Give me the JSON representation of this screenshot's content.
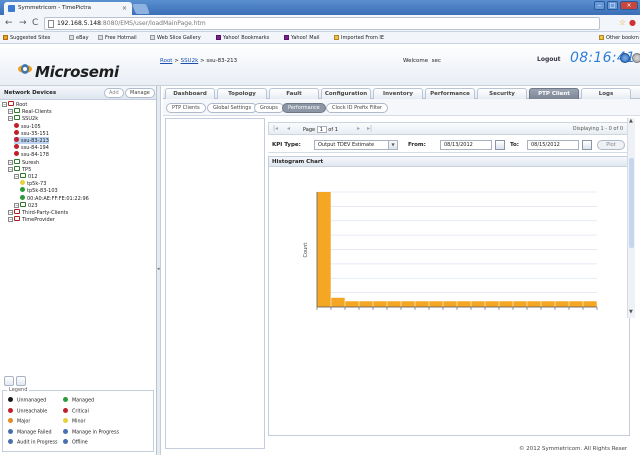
{
  "browser": {
    "tab_title": "Symmetricom - TimePictra",
    "url_host": "192.168.5.148",
    "url_path": ":8080/EMS/user/loadMainPage.htm",
    "bookmarks": [
      "Suggested Sites",
      "eBay",
      "Free Hotmail",
      "Web Slice Gallery",
      "Yahoo! Bookmarks",
      "Yahoo! Mail",
      "Imported From IE",
      "Other bookm"
    ]
  },
  "header": {
    "logo_text": "Microsemi",
    "breadcrumb_root": "Root",
    "breadcrumb_mid": "SSU2k",
    "breadcrumb_sep": " > ",
    "breadcrumb_current": "ssu-83-213",
    "welcome_label": "Welcome",
    "welcome_user": "sec",
    "logout": "Logout",
    "clock": "08:16:41"
  },
  "left_panel": {
    "title": "Network Devices",
    "add_label": "Add",
    "manage_label": "Manage",
    "tree": [
      {
        "label": "Root",
        "depth": 0,
        "icon": "folder",
        "color": "#b02020"
      },
      {
        "label": "Real-Clients",
        "depth": 1,
        "icon": "folder",
        "color": "#2d7a2d"
      },
      {
        "label": "SSU2k",
        "depth": 1,
        "icon": "folder",
        "color": "#2d7a2d"
      },
      {
        "label": "ssu-105",
        "depth": 2,
        "icon": "dot",
        "color": "#c0202a"
      },
      {
        "label": "ssu-35-151",
        "depth": 2,
        "icon": "dot",
        "color": "#c0202a"
      },
      {
        "label": "ssu-83-213",
        "depth": 2,
        "icon": "dot",
        "color": "#c0202a"
      },
      {
        "label": "ssu-84-194",
        "depth": 2,
        "icon": "dot",
        "color": "#c0202a"
      },
      {
        "label": "ssu-84-178",
        "depth": 2,
        "icon": "dot",
        "color": "#c0202a"
      },
      {
        "label": "Suresh",
        "depth": 1,
        "icon": "folder",
        "color": "#2d7a2d"
      },
      {
        "label": "TP5",
        "depth": 1,
        "icon": "folder",
        "color": "#2d7a2d"
      },
      {
        "label": "012",
        "depth": 2,
        "icon": "folder",
        "color": "#2d7a2d"
      },
      {
        "label": "tp5k-73",
        "depth": 3,
        "icon": "dot",
        "color": "#e3d23a"
      },
      {
        "label": "tp5k-83-103",
        "depth": 3,
        "icon": "dot",
        "color": "#2a9a3a"
      },
      {
        "label": "00:A0:AE:FF:FE:01:22:96",
        "depth": 3,
        "icon": "dot",
        "color": "#2a9a3a"
      },
      {
        "label": "023",
        "depth": 2,
        "icon": "folder",
        "color": "#2d7a2d"
      },
      {
        "label": "Third-Party-Clients",
        "depth": 1,
        "icon": "folder",
        "color": "#b02020"
      },
      {
        "label": "TimeProvider",
        "depth": 1,
        "icon": "folder",
        "color": "#b02020"
      }
    ],
    "legend": {
      "title": "Legend",
      "items": [
        {
          "label": "Unmanaged",
          "color": "#1a1a1a"
        },
        {
          "label": "Managed",
          "color": "#2a9a3a"
        },
        {
          "label": "Unreachable",
          "color": "#c0202a"
        },
        {
          "label": "Critical",
          "color": "#c0202a"
        },
        {
          "label": "Major",
          "color": "#e88a20"
        },
        {
          "label": "Minor",
          "color": "#e3d23a"
        },
        {
          "label": "Manage Failed",
          "color": "#4a6fb0"
        },
        {
          "label": "Manage in Progress",
          "color": "#4a6fb0"
        },
        {
          "label": "Audit in Progress",
          "color": "#4a6fb0"
        },
        {
          "label": "Offline",
          "color": "#4a6fb0"
        }
      ]
    }
  },
  "main_tabs": [
    "Dashboard",
    "Topology",
    "Fault",
    "Configuration",
    "Inventory",
    "Performance",
    "Security",
    "PTP Client",
    "Logs"
  ],
  "sub_tabs": [
    "PTP Clients",
    "Global Settings",
    "Groups",
    "Performance",
    "Clock ID Prefix Filter"
  ],
  "pager": {
    "page_label": "Page",
    "page_value": "1",
    "of_label": "of 1",
    "display": "Displaying 1 - 0 of 0"
  },
  "filter": {
    "kpi_label": "KPI Type:",
    "kpi_value": "Output TDEV Estimate",
    "from_label": "From:",
    "from_value": "08/13/2012",
    "to_label": "To:",
    "to_value": "08/15/2012",
    "plot_label": "Plot"
  },
  "chart_data": {
    "type": "bar",
    "title": "Histogram Chart",
    "ylabel": "Count",
    "xlabel": "",
    "bins": 20,
    "values": [
      100,
      8,
      5,
      5,
      5,
      5,
      5,
      5,
      5,
      5,
      5,
      5,
      5,
      5,
      5,
      5,
      5,
      5,
      5,
      5
    ],
    "ylim": [
      0,
      100
    ],
    "grid": true,
    "color": "#f5a623"
  },
  "footer": {
    "copyright": "© 2012 Symmetricom. All Rights Reser"
  },
  "colors": {
    "accent": "#2f7fd8",
    "bar": "#f5a623"
  }
}
